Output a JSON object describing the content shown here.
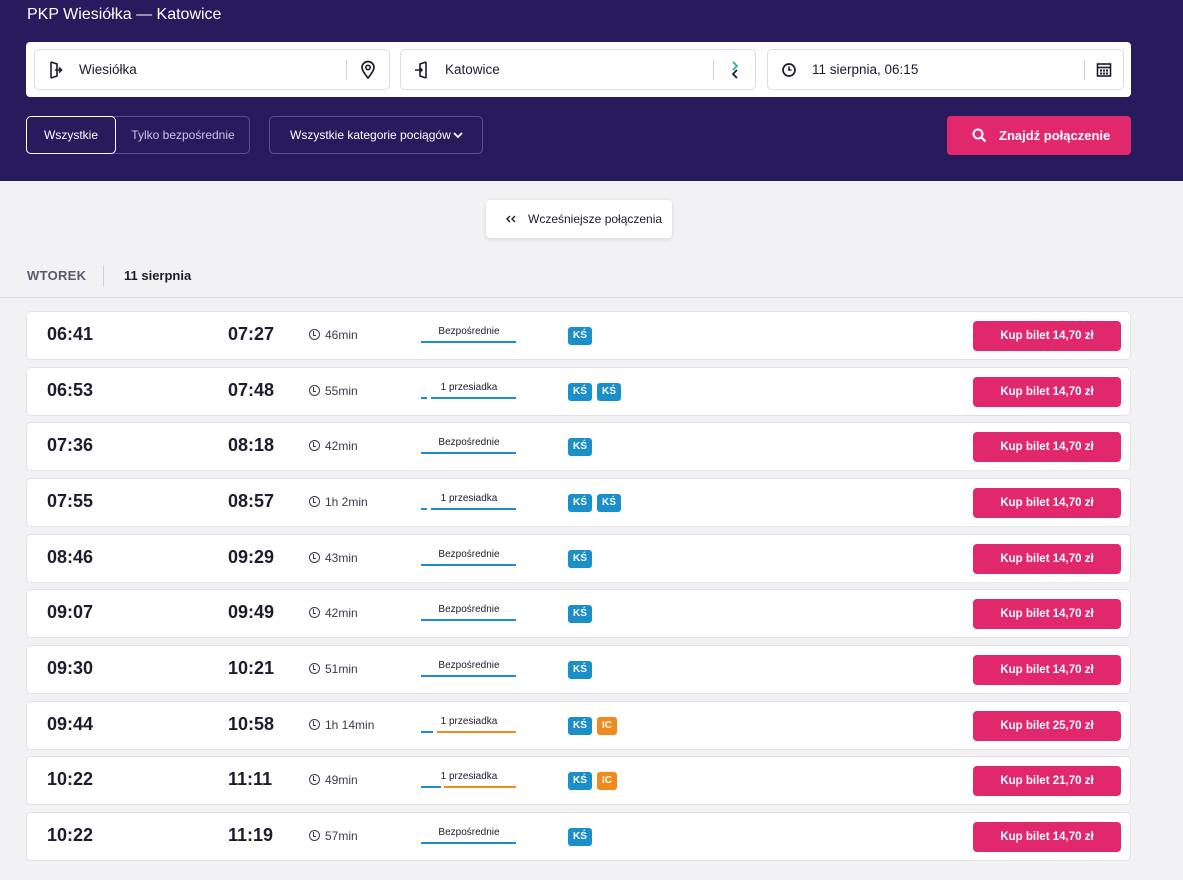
{
  "page": {
    "title": "PKP Wiesiółka — Katowice"
  },
  "search": {
    "from": "Wiesiółka",
    "to": "Katowice",
    "date": "11 sierpnia, 06:15"
  },
  "filters": {
    "all_label": "Wszystkie",
    "direct_label": "Tylko bezpośrednie",
    "category_label": "Wszystkie kategorie pociągów",
    "find_label": "Znajdź połączenie"
  },
  "earlier_label": "Wcześniejsze połączenia",
  "day": {
    "weekday": "WTOREK",
    "date": "11 sierpnia"
  },
  "colors": {
    "header_bg": "#271b5e",
    "accent": "#e2286d",
    "ks_blue": "#1a8fc9",
    "ic_orange": "#f08a1c"
  },
  "connections": [
    {
      "dep": "06:41",
      "arr": "07:27",
      "duration": "46min",
      "type": "Bezpośrednie",
      "carriers": [
        "KŚ"
      ],
      "buy": "Kup bilet 14,70 zł"
    },
    {
      "dep": "06:53",
      "arr": "07:48",
      "duration": "55min",
      "type": "1 przesiadka",
      "carriers": [
        "KŚ",
        "KŚ"
      ],
      "buy": "Kup bilet 14,70 zł"
    },
    {
      "dep": "07:36",
      "arr": "08:18",
      "duration": "42min",
      "type": "Bezpośrednie",
      "carriers": [
        "KŚ"
      ],
      "buy": "Kup bilet 14,70 zł"
    },
    {
      "dep": "07:55",
      "arr": "08:57",
      "duration": "1h 2min",
      "type": "1 przesiadka",
      "carriers": [
        "KŚ",
        "KŚ"
      ],
      "buy": "Kup bilet 14,70 zł"
    },
    {
      "dep": "08:46",
      "arr": "09:29",
      "duration": "43min",
      "type": "Bezpośrednie",
      "carriers": [
        "KŚ"
      ],
      "buy": "Kup bilet 14,70 zł"
    },
    {
      "dep": "09:07",
      "arr": "09:49",
      "duration": "42min",
      "type": "Bezpośrednie",
      "carriers": [
        "KŚ"
      ],
      "buy": "Kup bilet 14,70 zł"
    },
    {
      "dep": "09:30",
      "arr": "10:21",
      "duration": "51min",
      "type": "Bezpośrednie",
      "carriers": [
        "KŚ"
      ],
      "buy": "Kup bilet 14,70 zł"
    },
    {
      "dep": "09:44",
      "arr": "10:58",
      "duration": "1h 14min",
      "type": "1 przesiadka",
      "carriers": [
        "KŚ",
        "IC"
      ],
      "buy": "Kup bilet 25,70 zł"
    },
    {
      "dep": "10:22",
      "arr": "11:11",
      "duration": "49min",
      "type": "1 przesiadka",
      "carriers": [
        "KŚ",
        "IC"
      ],
      "buy": "Kup bilet 21,70 zł"
    },
    {
      "dep": "10:22",
      "arr": "11:19",
      "duration": "57min",
      "type": "Bezpośrednie",
      "carriers": [
        "KŚ"
      ],
      "buy": "Kup bilet 14,70 zł"
    }
  ]
}
